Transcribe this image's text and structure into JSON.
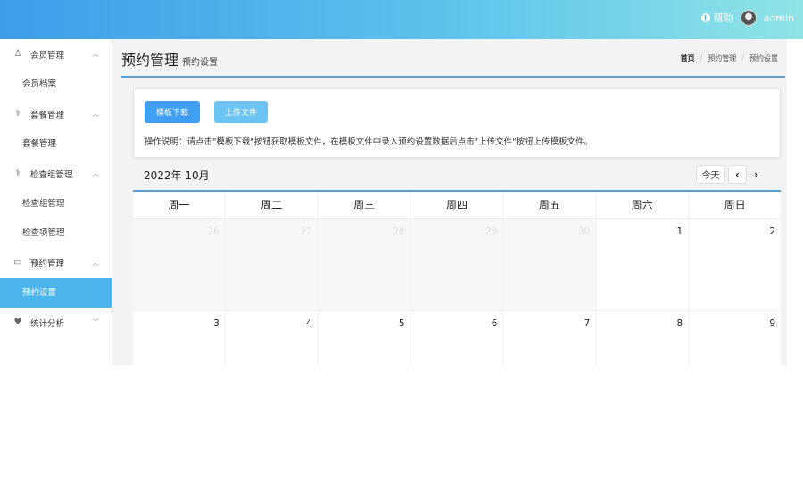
{
  "header": {
    "help_label": "帮助",
    "username": "admin"
  },
  "sidebar": {
    "groups": [
      {
        "label": "会员管理",
        "icon": "member-icon",
        "items": [
          "会员档案"
        ]
      },
      {
        "label": "套餐管理",
        "icon": "stethoscope-icon",
        "items": [
          "套餐管理"
        ]
      },
      {
        "label": "检查组管理",
        "icon": "stethoscope-icon",
        "items": [
          "检查组管理",
          "检查项管理"
        ]
      },
      {
        "label": "预约管理",
        "icon": "reservation-icon",
        "items": [
          "预约设置"
        ]
      },
      {
        "label": "统计分析",
        "icon": "heart-pulse-icon",
        "items": []
      }
    ],
    "active_item": "预约设置"
  },
  "page": {
    "title": "预约管理",
    "subtitle": "预约设置",
    "breadcrumb": [
      "首页",
      "预约管理",
      "预约设置"
    ]
  },
  "upload": {
    "download_label": "模板下载",
    "upload_label": "上传文件",
    "note": "操作说明：请点击\"模板下载\"按钮获取模板文件，在模板文件中录入预约设置数据后点击\"上传文件\"按钮上传模板文件。"
  },
  "calendar": {
    "month_label": "2022年 10月",
    "today_label": "今天",
    "prev_glyph": "‹",
    "next_glyph": "›",
    "weekdays": [
      "周一",
      "周二",
      "周三",
      "周四",
      "周五",
      "周六",
      "周日"
    ],
    "weeks": [
      [
        {
          "d": "26",
          "other": true
        },
        {
          "d": "27",
          "other": true
        },
        {
          "d": "28",
          "other": true
        },
        {
          "d": "29",
          "other": true
        },
        {
          "d": "30",
          "other": true
        },
        {
          "d": "1",
          "other": false
        },
        {
          "d": "2",
          "other": false
        }
      ],
      [
        {
          "d": "3",
          "other": false
        },
        {
          "d": "4",
          "other": false
        },
        {
          "d": "5",
          "other": false
        },
        {
          "d": "6",
          "other": false
        },
        {
          "d": "7",
          "other": false
        },
        {
          "d": "8",
          "other": false
        },
        {
          "d": "9",
          "other": false
        }
      ]
    ]
  },
  "colors": {
    "accent": "#409ef3",
    "active_menu": "#4db5ee"
  }
}
